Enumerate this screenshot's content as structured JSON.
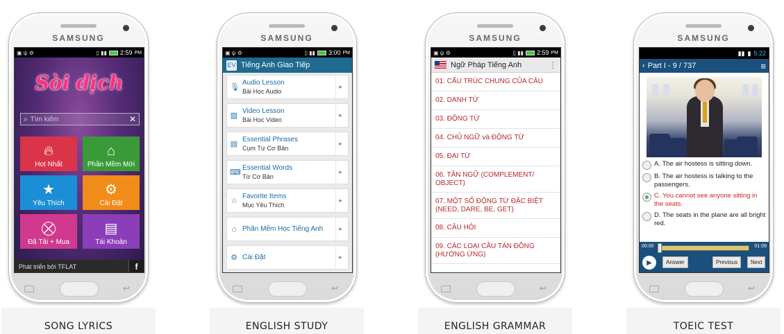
{
  "device": {
    "brand": "SAMSUNG"
  },
  "phones": [
    {
      "caption": "SONG LYRICS",
      "status_time": "2:59",
      "status_ampm": "PM",
      "logo": "Sòi dịch",
      "search_placeholder": "Tìm kiếm",
      "tiles": [
        {
          "label": "Hot Nhất",
          "color": "#d9344a",
          "icon": "flame-icon"
        },
        {
          "label": "Phần Mềm Mới",
          "color": "#3a9a3a",
          "icon": "house-icon"
        },
        {
          "label": "Yêu Thích",
          "color": "#1c8ed6",
          "icon": "star-icon"
        },
        {
          "label": "Cài Đặt",
          "color": "#f08c1a",
          "icon": "gear-icon"
        },
        {
          "label": "Đã Tải + Mua",
          "color": "#cf3a8e",
          "icon": "basket-icon"
        },
        {
          "label": "Tài Khoản",
          "color": "#8a3fb8",
          "icon": "id-card-icon"
        }
      ],
      "footer": "Phát triển bởi TFLAT",
      "fb": "f"
    },
    {
      "caption": "ENGLISH STUDY",
      "status_time": "3:00",
      "status_ampm": "PM",
      "app_title": "Tiếng Anh Giao Tiếp",
      "items": [
        {
          "title": "Audio Lesson",
          "subtitle": "Bài Học Audio",
          "icon": "microphone-icon"
        },
        {
          "title": "Video Lesson",
          "subtitle": "Bài Học Video",
          "icon": "image-icon"
        },
        {
          "title": "Essential Phrases",
          "subtitle": "Cụm Từ Cơ Bản",
          "icon": "document-icon"
        },
        {
          "title": "Essential Words",
          "subtitle": "Từ Cơ Bản",
          "icon": "keyboard-icon"
        },
        {
          "title": "Favorite Items",
          "subtitle": "Mục Yêu Thích",
          "icon": "star-icon"
        },
        {
          "title": "Phần Mềm Học Tiếng Anh",
          "subtitle": "",
          "icon": "house-icon"
        },
        {
          "title": "Cài Đặt",
          "subtitle": "",
          "icon": "gear-icon"
        }
      ]
    },
    {
      "caption": "ENGLISH GRAMMAR",
      "status_time": "2:59",
      "status_ampm": "PM",
      "app_title": "Ngữ Pháp Tiếng Anh",
      "items": [
        "01. CẤU TRÚC CHUNG CỦA CÂU",
        "02. DANH TỪ",
        "03. ĐỘNG TỪ",
        "04. CHỦ NGỮ và ĐỘNG TỪ",
        "05. ĐẠI TỪ",
        "06. TÂN NGỮ (COMPLEMENT/ OBJECT)",
        "07. MỘT SỐ ĐỘNG TỪ ĐẶC BIỆT (NEED, DARE, BE, GET)",
        "08. CÂU HỎI",
        "09. CÁC LOẠI CÂU TÁN ĐỒNG (HƯỚNG ỨNG)"
      ]
    },
    {
      "caption": "TOEIC TEST",
      "status_time": "5:22",
      "nav_title": "Part I - 9 / 737",
      "options": [
        {
          "text": "A. The air hostess is sitting down.",
          "selected": false
        },
        {
          "text": "B. The air hostess is talking to the passengers.",
          "selected": false
        },
        {
          "text": "C. You cannot see anyone sitting in the seats.",
          "selected": true
        },
        {
          "text": "D. The seats in the plane are all bright red.",
          "selected": false
        }
      ],
      "audio": {
        "current": "00:00",
        "total": "01:09",
        "progress": 0.0
      },
      "buttons": {
        "answer": "Answer",
        "previous": "Previous",
        "next": "Next"
      }
    }
  ]
}
